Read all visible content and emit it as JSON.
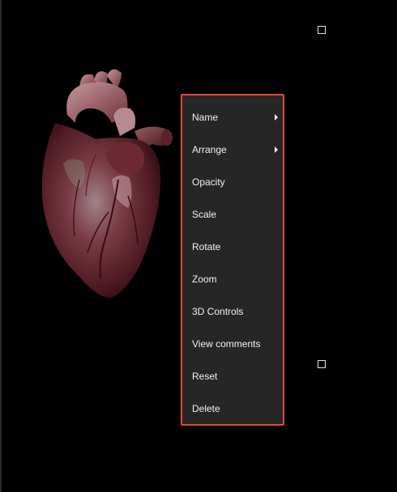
{
  "canvas": {
    "background": "#000000",
    "model": "human heart 3D model",
    "selection_handles": [
      "selection-handle-top",
      "selection-handle-bottom"
    ]
  },
  "context_menu": {
    "border_color": "#e1493f",
    "background": "#262626",
    "items": [
      {
        "label": "Name",
        "has_submenu": true
      },
      {
        "label": "Arrange",
        "has_submenu": true
      },
      {
        "label": "Opacity",
        "has_submenu": false
      },
      {
        "label": "Scale",
        "has_submenu": false
      },
      {
        "label": "Rotate",
        "has_submenu": false
      },
      {
        "label": "Zoom",
        "has_submenu": false
      },
      {
        "label": "3D Controls",
        "has_submenu": false
      },
      {
        "label": "View comments",
        "has_submenu": false
      },
      {
        "label": "Reset",
        "has_submenu": false
      },
      {
        "label": "Delete",
        "has_submenu": false
      }
    ]
  }
}
